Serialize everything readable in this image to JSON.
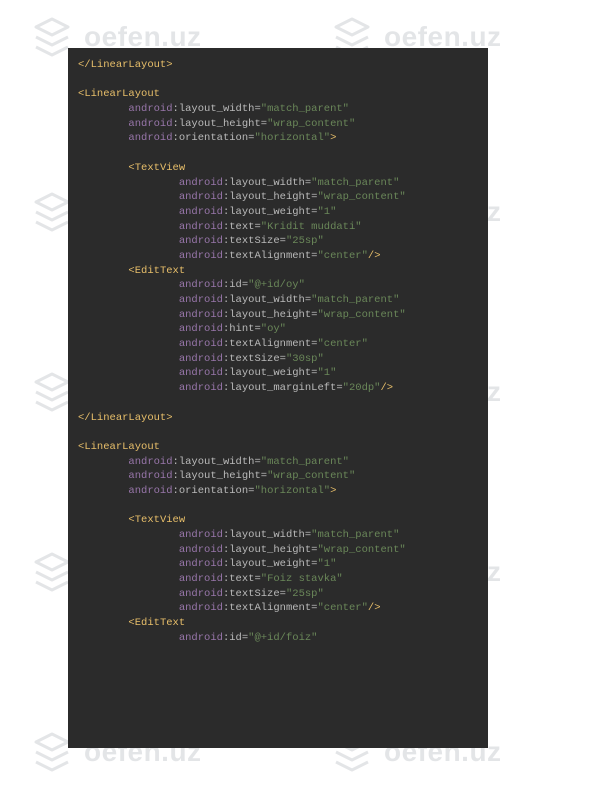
{
  "watermark": "oefen.uz",
  "code_lines": [
    {
      "indent": 0,
      "parts": [
        {
          "t": "</",
          "c": "tag"
        },
        {
          "t": "LinearLayout",
          "c": "tag"
        },
        {
          "t": ">",
          "c": "tag"
        }
      ]
    },
    {
      "blank": true
    },
    {
      "indent": 0,
      "parts": [
        {
          "t": "<",
          "c": "tag"
        },
        {
          "t": "LinearLayout",
          "c": "tag"
        }
      ]
    },
    {
      "indent": 2,
      "parts": [
        {
          "t": "android",
          "c": "ns"
        },
        {
          "t": ":layout_width",
          "c": "attr"
        },
        {
          "t": "=",
          "c": "attr"
        },
        {
          "t": "\"match_parent\"",
          "c": "val"
        }
      ]
    },
    {
      "indent": 2,
      "parts": [
        {
          "t": "android",
          "c": "ns"
        },
        {
          "t": ":layout_height",
          "c": "attr"
        },
        {
          "t": "=",
          "c": "attr"
        },
        {
          "t": "\"wrap_content\"",
          "c": "val"
        }
      ]
    },
    {
      "indent": 2,
      "parts": [
        {
          "t": "android",
          "c": "ns"
        },
        {
          "t": ":orientation",
          "c": "attr"
        },
        {
          "t": "=",
          "c": "attr"
        },
        {
          "t": "\"horizontal\"",
          "c": "val"
        },
        {
          "t": ">",
          "c": "tag"
        }
      ]
    },
    {
      "blank": true
    },
    {
      "indent": 2,
      "parts": [
        {
          "t": "<",
          "c": "tag"
        },
        {
          "t": "TextView",
          "c": "tag"
        }
      ]
    },
    {
      "indent": 4,
      "parts": [
        {
          "t": "android",
          "c": "ns"
        },
        {
          "t": ":layout_width",
          "c": "attr"
        },
        {
          "t": "=",
          "c": "attr"
        },
        {
          "t": "\"match_parent\"",
          "c": "val"
        }
      ]
    },
    {
      "indent": 4,
      "parts": [
        {
          "t": "android",
          "c": "ns"
        },
        {
          "t": ":layout_height",
          "c": "attr"
        },
        {
          "t": "=",
          "c": "attr"
        },
        {
          "t": "\"wrap_content\"",
          "c": "val"
        }
      ]
    },
    {
      "indent": 4,
      "parts": [
        {
          "t": "android",
          "c": "ns"
        },
        {
          "t": ":layout_weight",
          "c": "attr"
        },
        {
          "t": "=",
          "c": "attr"
        },
        {
          "t": "\"1\"",
          "c": "val"
        }
      ]
    },
    {
      "indent": 4,
      "parts": [
        {
          "t": "android",
          "c": "ns"
        },
        {
          "t": ":text",
          "c": "attr"
        },
        {
          "t": "=",
          "c": "attr"
        },
        {
          "t": "\"Kridit muddati\"",
          "c": "val"
        }
      ]
    },
    {
      "indent": 4,
      "parts": [
        {
          "t": "android",
          "c": "ns"
        },
        {
          "t": ":textSize",
          "c": "attr"
        },
        {
          "t": "=",
          "c": "attr"
        },
        {
          "t": "\"25sp\"",
          "c": "val"
        }
      ]
    },
    {
      "indent": 4,
      "parts": [
        {
          "t": "android",
          "c": "ns"
        },
        {
          "t": ":textAlignment",
          "c": "attr"
        },
        {
          "t": "=",
          "c": "attr"
        },
        {
          "t": "\"center\"",
          "c": "val"
        },
        {
          "t": "/>",
          "c": "tag"
        }
      ]
    },
    {
      "indent": 2,
      "parts": [
        {
          "t": "<",
          "c": "tag"
        },
        {
          "t": "EditText",
          "c": "tag"
        }
      ]
    },
    {
      "indent": 4,
      "parts": [
        {
          "t": "android",
          "c": "ns"
        },
        {
          "t": ":id",
          "c": "attr"
        },
        {
          "t": "=",
          "c": "attr"
        },
        {
          "t": "\"@+id/oy\"",
          "c": "val"
        }
      ]
    },
    {
      "indent": 4,
      "parts": [
        {
          "t": "android",
          "c": "ns"
        },
        {
          "t": ":layout_width",
          "c": "attr"
        },
        {
          "t": "=",
          "c": "attr"
        },
        {
          "t": "\"match_parent\"",
          "c": "val"
        }
      ]
    },
    {
      "indent": 4,
      "parts": [
        {
          "t": "android",
          "c": "ns"
        },
        {
          "t": ":layout_height",
          "c": "attr"
        },
        {
          "t": "=",
          "c": "attr"
        },
        {
          "t": "\"wrap_content\"",
          "c": "val"
        }
      ]
    },
    {
      "indent": 4,
      "parts": [
        {
          "t": "android",
          "c": "ns"
        },
        {
          "t": ":hint",
          "c": "attr"
        },
        {
          "t": "=",
          "c": "attr"
        },
        {
          "t": "\"oy\"",
          "c": "val"
        }
      ]
    },
    {
      "indent": 4,
      "parts": [
        {
          "t": "android",
          "c": "ns"
        },
        {
          "t": ":textAlignment",
          "c": "attr"
        },
        {
          "t": "=",
          "c": "attr"
        },
        {
          "t": "\"center\"",
          "c": "val"
        }
      ]
    },
    {
      "indent": 4,
      "parts": [
        {
          "t": "android",
          "c": "ns"
        },
        {
          "t": ":textSize",
          "c": "attr"
        },
        {
          "t": "=",
          "c": "attr"
        },
        {
          "t": "\"30sp\"",
          "c": "val"
        }
      ]
    },
    {
      "indent": 4,
      "parts": [
        {
          "t": "android",
          "c": "ns"
        },
        {
          "t": ":layout_weight",
          "c": "attr"
        },
        {
          "t": "=",
          "c": "attr"
        },
        {
          "t": "\"1\"",
          "c": "val"
        }
      ]
    },
    {
      "indent": 4,
      "parts": [
        {
          "t": "android",
          "c": "ns"
        },
        {
          "t": ":layout_marginLeft",
          "c": "attr"
        },
        {
          "t": "=",
          "c": "attr"
        },
        {
          "t": "\"20dp\"",
          "c": "val"
        },
        {
          "t": "/>",
          "c": "tag"
        }
      ]
    },
    {
      "blank": true
    },
    {
      "indent": 0,
      "parts": [
        {
          "t": "</",
          "c": "tag"
        },
        {
          "t": "LinearLayout",
          "c": "tag"
        },
        {
          "t": ">",
          "c": "tag"
        }
      ]
    },
    {
      "blank": true
    },
    {
      "indent": 0,
      "parts": [
        {
          "t": "<",
          "c": "tag"
        },
        {
          "t": "LinearLayout",
          "c": "tag"
        }
      ]
    },
    {
      "indent": 2,
      "parts": [
        {
          "t": "android",
          "c": "ns"
        },
        {
          "t": ":layout_width",
          "c": "attr"
        },
        {
          "t": "=",
          "c": "attr"
        },
        {
          "t": "\"match_parent\"",
          "c": "val"
        }
      ]
    },
    {
      "indent": 2,
      "parts": [
        {
          "t": "android",
          "c": "ns"
        },
        {
          "t": ":layout_height",
          "c": "attr"
        },
        {
          "t": "=",
          "c": "attr"
        },
        {
          "t": "\"wrap_content\"",
          "c": "val"
        }
      ]
    },
    {
      "indent": 2,
      "parts": [
        {
          "t": "android",
          "c": "ns"
        },
        {
          "t": ":orientation",
          "c": "attr"
        },
        {
          "t": "=",
          "c": "attr"
        },
        {
          "t": "\"horizontal\"",
          "c": "val"
        },
        {
          "t": ">",
          "c": "tag"
        }
      ]
    },
    {
      "blank": true
    },
    {
      "indent": 2,
      "parts": [
        {
          "t": "<",
          "c": "tag"
        },
        {
          "t": "TextView",
          "c": "tag"
        }
      ]
    },
    {
      "indent": 4,
      "parts": [
        {
          "t": "android",
          "c": "ns"
        },
        {
          "t": ":layout_width",
          "c": "attr"
        },
        {
          "t": "=",
          "c": "attr"
        },
        {
          "t": "\"match_parent\"",
          "c": "val"
        }
      ]
    },
    {
      "indent": 4,
      "parts": [
        {
          "t": "android",
          "c": "ns"
        },
        {
          "t": ":layout_height",
          "c": "attr"
        },
        {
          "t": "=",
          "c": "attr"
        },
        {
          "t": "\"wrap_content\"",
          "c": "val"
        }
      ]
    },
    {
      "indent": 4,
      "parts": [
        {
          "t": "android",
          "c": "ns"
        },
        {
          "t": ":layout_weight",
          "c": "attr"
        },
        {
          "t": "=",
          "c": "attr"
        },
        {
          "t": "\"1\"",
          "c": "val"
        }
      ]
    },
    {
      "indent": 4,
      "parts": [
        {
          "t": "android",
          "c": "ns"
        },
        {
          "t": ":text",
          "c": "attr"
        },
        {
          "t": "=",
          "c": "attr"
        },
        {
          "t": "\"Foiz stavka\"",
          "c": "val"
        }
      ]
    },
    {
      "indent": 4,
      "parts": [
        {
          "t": "android",
          "c": "ns"
        },
        {
          "t": ":textSize",
          "c": "attr"
        },
        {
          "t": "=",
          "c": "attr"
        },
        {
          "t": "\"25sp\"",
          "c": "val"
        }
      ]
    },
    {
      "indent": 4,
      "parts": [
        {
          "t": "android",
          "c": "ns"
        },
        {
          "t": ":textAlignment",
          "c": "attr"
        },
        {
          "t": "=",
          "c": "attr"
        },
        {
          "t": "\"center\"",
          "c": "val"
        },
        {
          "t": "/>",
          "c": "tag"
        }
      ]
    },
    {
      "indent": 2,
      "parts": [
        {
          "t": "<",
          "c": "tag"
        },
        {
          "t": "EditText",
          "c": "tag"
        }
      ]
    },
    {
      "indent": 4,
      "parts": [
        {
          "t": "android",
          "c": "ns"
        },
        {
          "t": ":id",
          "c": "attr"
        },
        {
          "t": "=",
          "c": "attr"
        },
        {
          "t": "\"@+id/foiz\"",
          "c": "val"
        }
      ]
    }
  ]
}
